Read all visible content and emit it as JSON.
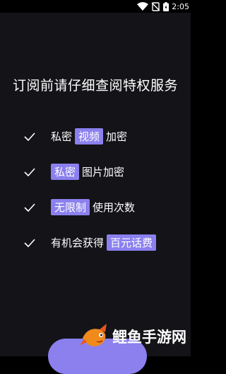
{
  "status_bar": {
    "time": "2:05",
    "icons": [
      "wifi-icon",
      "no-sim-icon",
      "battery-charging-icon"
    ]
  },
  "headline": "订阅前请仔细查阅特权服务",
  "features": [
    {
      "icon": "check-icon",
      "before": "私密",
      "highlight": "视频",
      "after": "加密"
    },
    {
      "icon": "check-icon",
      "before": "",
      "highlight": "私密",
      "after": "图片加密"
    },
    {
      "icon": "check-icon",
      "before": "",
      "highlight": "无限制",
      "after": "使用次数"
    },
    {
      "icon": "check-icon",
      "before": "有机会获得",
      "highlight": "百元话费",
      "after": ""
    }
  ],
  "watermark": {
    "logo": "fish-logo",
    "text": "鲤鱼手游网"
  },
  "colors": {
    "accent": "#8b80ee",
    "background": "#131318",
    "text": "#ffffff"
  }
}
